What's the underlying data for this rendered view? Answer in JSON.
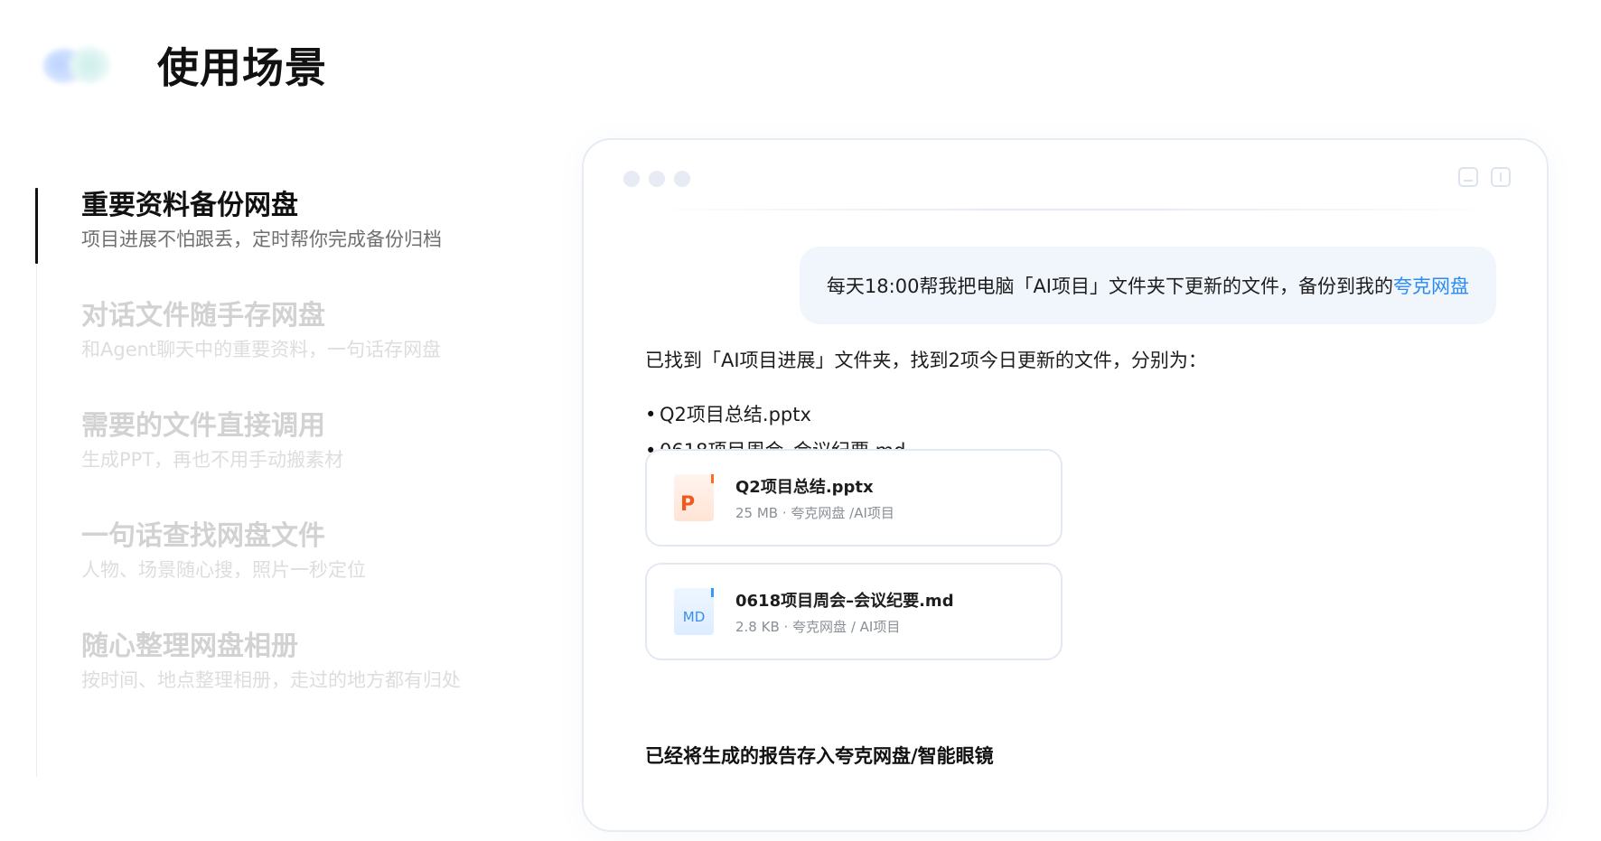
{
  "header": {
    "title": "使用场景"
  },
  "nav": {
    "items": [
      {
        "title": "重要资料备份网盘",
        "desc": "项目进展不怕跟丢，定时帮你完成备份归档",
        "active": true
      },
      {
        "title": "对话文件随手存网盘",
        "desc": "和Agent聊天中的重要资料，一句话存网盘",
        "active": false
      },
      {
        "title": "需要的文件直接调用",
        "desc": "生成PPT，再也不用手动搬素材",
        "active": false
      },
      {
        "title": "一句话查找网盘文件",
        "desc": "人物、场景随心搜，照片一秒定位",
        "active": false
      },
      {
        "title": "随心整理网盘相册",
        "desc": "按时间、地点整理相册，走过的地方都有归处",
        "active": false
      }
    ]
  },
  "chat": {
    "user_message": "每天18:00帮我把电脑「AI项目」文件夹下更新的文件，备份到我的",
    "user_message_highlight": "夸克网盘",
    "reply": "已找到「AI项目进展」文件夹，找到2项今日更新的文件，分别为：",
    "bullets": [
      "Q2项目总结.pptx",
      "0618项目周会–会议纪要.md"
    ],
    "files": [
      {
        "icon": "ppt-file-icon",
        "glyph": "P",
        "name": "Q2项目总结.pptx",
        "meta": "25 MB · 夸克网盘 /AI项目"
      },
      {
        "icon": "md-file-icon",
        "glyph": "MD",
        "name": "0618项目周会–会议纪要.md",
        "meta": "2.8 KB · 夸克网盘 / AI项目"
      }
    ],
    "final": "已经将生成的报告存入夸克网盘/智能眼镜"
  },
  "colors": {
    "highlight": "#2a8bf2",
    "bubble_bg": "#f1f6fc",
    "ppt_accent": "#f15a1c",
    "md_accent": "#3a8ef0"
  }
}
